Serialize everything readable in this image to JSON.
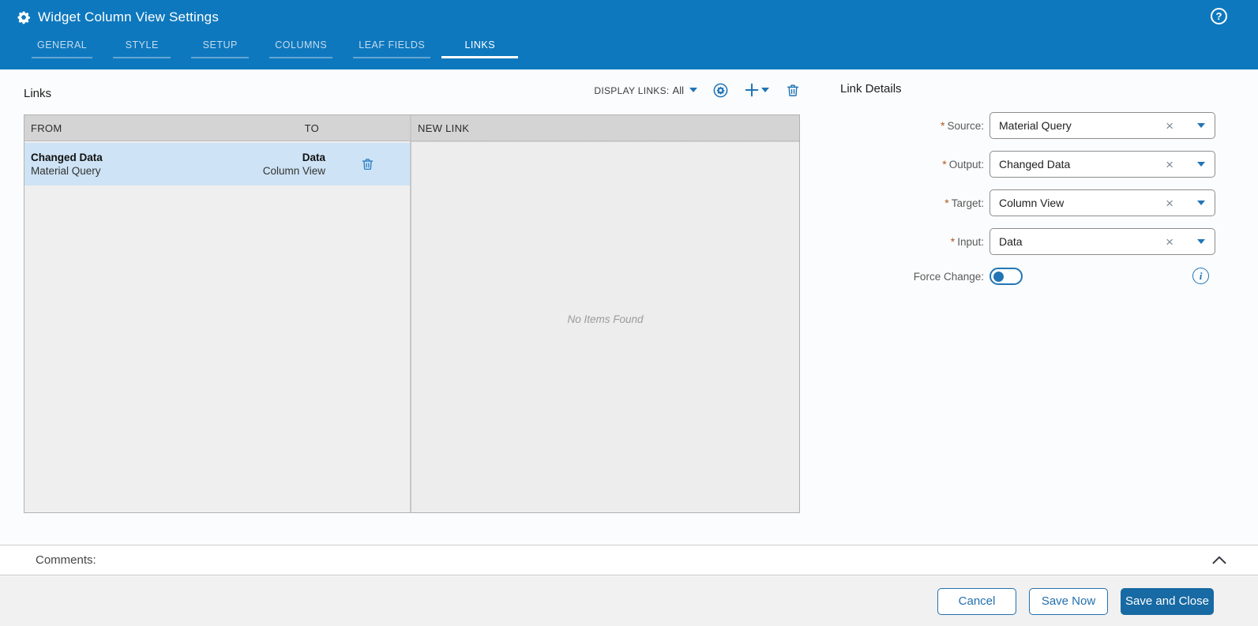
{
  "window": {
    "title": "Widget Column View Settings",
    "help_icon": "?"
  },
  "tabs": [
    {
      "label": "GENERAL",
      "active": false
    },
    {
      "label": "STYLE",
      "active": false
    },
    {
      "label": "SETUP",
      "active": false
    },
    {
      "label": "COLUMNS",
      "active": false
    },
    {
      "label": "LEAF FIELDS",
      "active": false
    },
    {
      "label": "LINKS",
      "active": true
    }
  ],
  "links_panel": {
    "title": "Links",
    "toolbar": {
      "display_links_label": "DISPLAY LINKS:",
      "display_links_value": "All"
    },
    "table": {
      "from_header": "FROM",
      "to_header": "TO",
      "rows": [
        {
          "from_output": "Changed Data",
          "from_widget": "Material Query",
          "to_input": "Data",
          "to_widget": "Column View",
          "selected": true
        }
      ]
    },
    "new_link_panel": {
      "header": "NEW LINK",
      "empty_message": "No Items Found"
    }
  },
  "link_details": {
    "title": "Link Details",
    "required_marker": "*",
    "clear_glyph": "×",
    "fields": [
      {
        "label": "Source:",
        "value": "Material Query",
        "required": true
      },
      {
        "label": "Output:",
        "value": "Changed Data",
        "required": true
      },
      {
        "label": "Target:",
        "value": "Column View",
        "required": true
      },
      {
        "label": "Input:",
        "value": "Data",
        "required": true
      }
    ],
    "force_change": {
      "label": "Force Change:",
      "enabled": false
    }
  },
  "comments": {
    "label": "Comments:"
  },
  "footer": {
    "cancel_label": "Cancel",
    "save_now_label": "Save Now",
    "save_close_label": "Save and Close"
  },
  "icons": {
    "gear": "settings-gear",
    "help": "question-mark-circle",
    "display_links_caret": "chevron-down",
    "toolbar_gear_circle": "gear-in-circle",
    "toolbar_plus": "plus",
    "toolbar_trash": "trash-can",
    "row_trash": "trash-can",
    "select_clear": "x-clear",
    "select_caret": "chevron-down",
    "info": "info-circle",
    "comments_collapse": "chevron-up"
  },
  "colors": {
    "header_bg": "#0e78be",
    "accent_blue": "#2175b6",
    "selected_row_bg": "#cee3f5",
    "table_header_bg": "#d4d4d4",
    "primary_button_bg": "#176aa3",
    "required_asterisk": "#b0561c"
  }
}
